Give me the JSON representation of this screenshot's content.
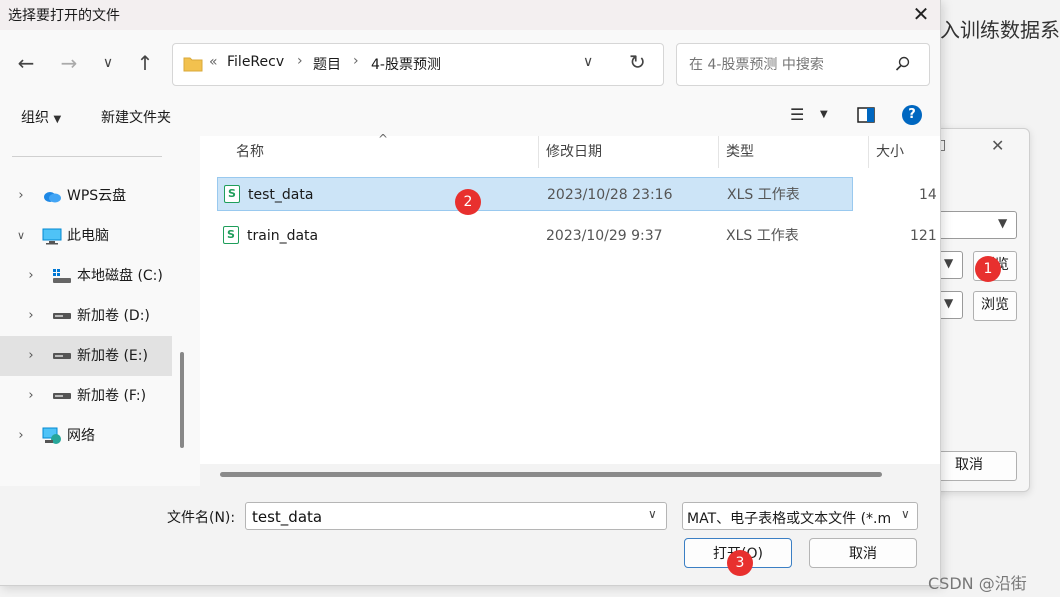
{
  "background_app": {
    "title_fragment": "入训练数据系",
    "browse_label_1": "浏览",
    "browse_label_2": "浏览",
    "cancel_label": "取消",
    "close_glyph": "✕",
    "min_glyph": "□"
  },
  "dialog": {
    "title": "选择要打开的文件",
    "address": {
      "overflow": "«",
      "crumbs": [
        "FileRecv",
        "题目",
        "4-股票预测"
      ]
    },
    "search_placeholder": "在 4-股票预测 中搜索",
    "toolbar": {
      "organize_label": "组织",
      "new_folder_label": "新建文件夹"
    },
    "nav_items": [
      {
        "label": "WPS云盘",
        "icon": "cloud-icon"
      },
      {
        "label": "此电脑",
        "icon": "computer-icon"
      },
      {
        "label": "本地磁盘 (C:)",
        "icon": "drive-icon"
      },
      {
        "label": "新加卷 (D:)",
        "icon": "drive-icon"
      },
      {
        "label": "新加卷 (E:)",
        "icon": "drive-icon",
        "selected": true
      },
      {
        "label": "新加卷 (F:)",
        "icon": "drive-icon"
      },
      {
        "label": "网络",
        "icon": "network-icon"
      }
    ],
    "columns": {
      "name": "名称",
      "date": "修改日期",
      "type": "类型",
      "size": "大小"
    },
    "files": [
      {
        "name": "test_data",
        "date": "2023/10/28 23:16",
        "type": "XLS 工作表",
        "size": "14",
        "selected": true
      },
      {
        "name": "train_data",
        "date": "2023/10/29 9:37",
        "type": "XLS 工作表",
        "size": "121",
        "selected": false
      }
    ],
    "filename_label": "文件名(N):",
    "filename_value": "test_data",
    "filetype_value": "MAT、电子表格或文本文件 (*.m",
    "open_label": "打开(O)",
    "cancel_label": "取消"
  },
  "markers": [
    "1",
    "2",
    "3"
  ],
  "watermark": "CSDN @沿街",
  "colors": {
    "selection": "#cce4f7",
    "marker": "#e8302e",
    "folder": "#f2c14e",
    "accent": "#0067c0"
  }
}
